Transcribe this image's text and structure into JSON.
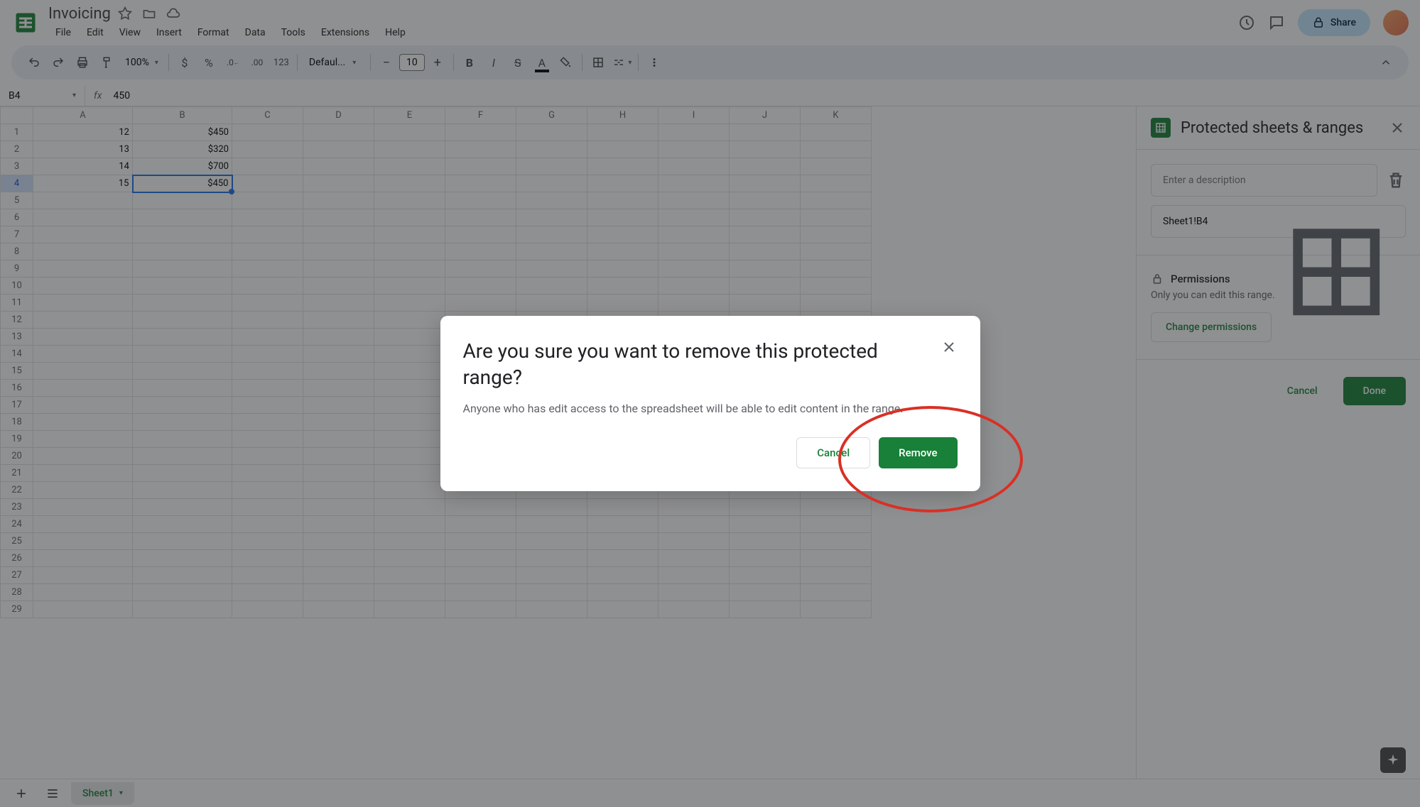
{
  "header": {
    "doc_title": "Invoicing",
    "menu": [
      "File",
      "Edit",
      "View",
      "Insert",
      "Format",
      "Data",
      "Tools",
      "Extensions",
      "Help"
    ],
    "share_label": "Share"
  },
  "toolbar": {
    "zoom": "100%",
    "font_name": "Defaul...",
    "font_size": "10",
    "number_format": "123"
  },
  "formula_bar": {
    "name_box": "B4",
    "formula": "450"
  },
  "grid": {
    "columns": [
      "A",
      "B",
      "C",
      "D",
      "E",
      "F",
      "G",
      "H",
      "I",
      "J",
      "K"
    ],
    "rows_count": 29,
    "selected_cell": "B4",
    "data": [
      {
        "row": 1,
        "A": "12",
        "B": "$450"
      },
      {
        "row": 2,
        "A": "13",
        "B": "$320"
      },
      {
        "row": 3,
        "A": "14",
        "B": "$700"
      },
      {
        "row": 4,
        "A": "15",
        "B": "$450"
      }
    ]
  },
  "sidebar": {
    "title": "Protected sheets & ranges",
    "desc_placeholder": "Enter a description",
    "range_value": "Sheet1!B4",
    "permissions_label": "Permissions",
    "permissions_desc": "Only you can edit this range.",
    "change_perm_label": "Change permissions",
    "cancel_label": "Cancel",
    "done_label": "Done"
  },
  "modal": {
    "title": "Are you sure you want to remove this protected range?",
    "text": "Anyone who has edit access to the spreadsheet will be able to edit content in the range.",
    "cancel_label": "Cancel",
    "remove_label": "Remove"
  },
  "bottom": {
    "sheet_name": "Sheet1"
  }
}
